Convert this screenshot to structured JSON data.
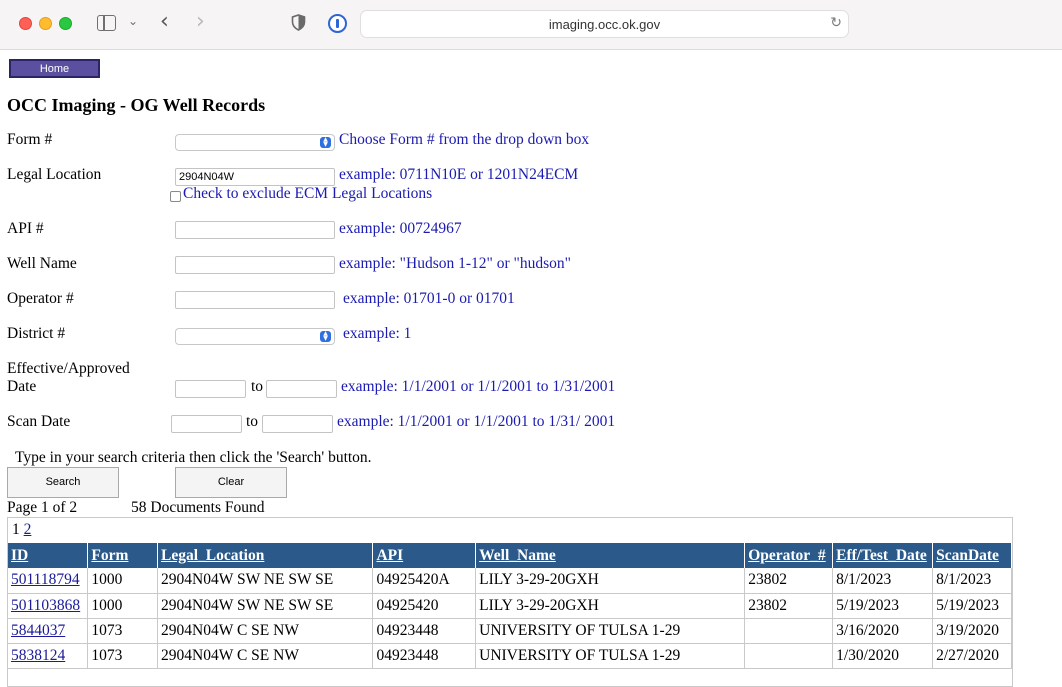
{
  "browser": {
    "url": "imaging.occ.ok.gov",
    "icons": [
      "sidebar-icon",
      "chevron-down-icon",
      "back-icon",
      "forward-icon",
      "shield-icon",
      "password-manager-icon",
      "reload-icon"
    ]
  },
  "nav": {
    "home_label": "Home"
  },
  "page_title": "OCC Imaging - OG Well Records",
  "form": {
    "form_no": {
      "label": "Form #",
      "hint": "Choose Form # from the drop down box",
      "value": ""
    },
    "legal": {
      "label": "Legal Location",
      "value": "2904N04W",
      "hint": "example: 0711N10E or 1201N24ECM",
      "exclude_label": "Check to exclude ECM Legal Locations"
    },
    "api": {
      "label": "API #",
      "hint": "example: 00724967",
      "value": ""
    },
    "well_name": {
      "label": "Well Name",
      "hint": "example: \"Hudson 1-12\" or \"hudson\"",
      "value": ""
    },
    "operator": {
      "label": "Operator #",
      "hint": "example: 01701-0 or 01701",
      "value": ""
    },
    "district": {
      "label": "District #",
      "hint": "example: 1",
      "value": ""
    },
    "effective": {
      "label_line1": "Effective/Approved",
      "label_line2": "Date",
      "to": "to",
      "hint": "example: 1/1/2001 or 1/1/2001 to 1/31/2001"
    },
    "scan": {
      "label": "Scan Date",
      "to": "to",
      "hint": "example: 1/1/2001 or 1/1/2001 to 1/31/ 2001"
    }
  },
  "instructions": "Type in your search criteria then click the 'Search' button.",
  "buttons": {
    "search": "Search",
    "clear": "Clear"
  },
  "results": {
    "page_info": "Page 1 of 2",
    "docs_found": "58 Documents Found",
    "pages": [
      "1",
      "2"
    ],
    "columns": [
      "ID",
      "Form",
      "Legal_Location",
      "API",
      "Well_Name",
      "Operator_#",
      "Eff/Test_Date",
      "ScanDate"
    ],
    "rows": [
      [
        "501118794",
        "1000",
        "2904N04W SW NE SW SE",
        "04925420A",
        "LILY 3-29-20GXH",
        "23802",
        "8/1/2023",
        "8/1/2023"
      ],
      [
        "501103868",
        "1000",
        "2904N04W SW NE SW SE",
        "04925420",
        "LILY 3-29-20GXH",
        "23802",
        "5/19/2023",
        "5/19/2023"
      ],
      [
        "5844037",
        "1073",
        "2904N04W C SE NW",
        "04923448",
        "UNIVERSITY OF TULSA 1-29",
        "",
        "3/16/2020",
        "3/19/2020"
      ],
      [
        "5838124",
        "1073",
        "2904N04W C SE NW",
        "04923448",
        "UNIVERSITY OF TULSA 1-29",
        "",
        "1/30/2020",
        "2/27/2020"
      ]
    ]
  }
}
